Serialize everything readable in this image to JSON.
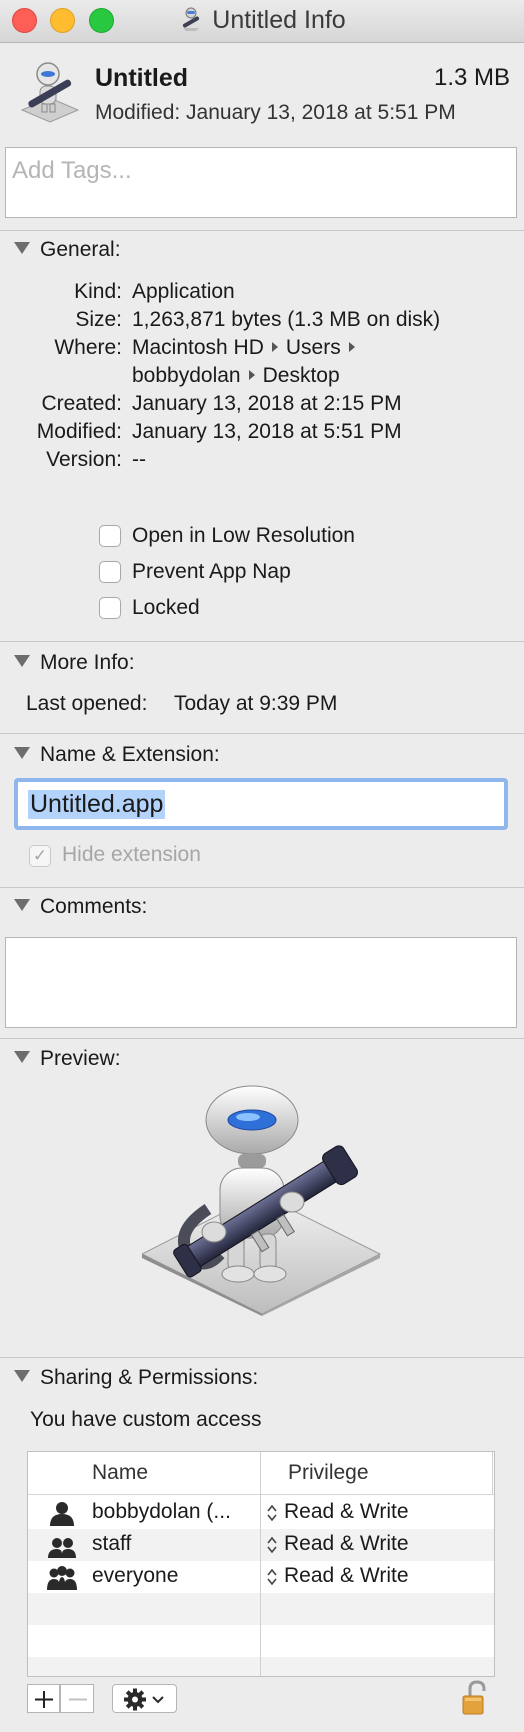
{
  "window": {
    "title": "Untitled Info",
    "title_icon": "automator-icon"
  },
  "header": {
    "name": "Untitled",
    "size": "1.3 MB",
    "modified": "Modified:  January 13, 2018 at 5:51 PM"
  },
  "tags": {
    "placeholder": "Add Tags..."
  },
  "general": {
    "title": "General:",
    "rows": [
      {
        "label": "Kind:",
        "value": "Application"
      },
      {
        "label": "Size:",
        "value": "1,263,871 bytes (1.3 MB on disk)"
      },
      {
        "label": "Where:",
        "value_parts": [
          "Macintosh HD",
          "Users",
          "bobbydolan",
          "Desktop"
        ]
      },
      {
        "label": "Created:",
        "value": "January 13, 2018 at 2:15 PM"
      },
      {
        "label": "Modified:",
        "value": "January 13, 2018 at 5:51 PM"
      },
      {
        "label": "Version:",
        "value": "--"
      }
    ],
    "checkboxes": [
      {
        "label": "Open in Low Resolution",
        "checked": false
      },
      {
        "label": "Prevent App Nap",
        "checked": false
      },
      {
        "label": "Locked",
        "checked": false
      }
    ]
  },
  "more_info": {
    "title": "More Info:",
    "last_opened_label": "Last opened:",
    "last_opened_value": "Today at 9:39 PM"
  },
  "name_extension": {
    "title": "Name & Extension:",
    "value": "Untitled.app",
    "hide_extension_label": "Hide extension",
    "hide_extension_checked": true,
    "hide_extension_mark": "✓"
  },
  "comments": {
    "title": "Comments:"
  },
  "preview": {
    "title": "Preview:",
    "image": "automator-robot-icon"
  },
  "sharing": {
    "title": "Sharing & Permissions:",
    "access_text": "You have custom access",
    "columns": [
      "Name",
      "Privilege"
    ],
    "rows": [
      {
        "name": "bobbydolan (...",
        "privilege": "Read & Write",
        "icon": "user-icon"
      },
      {
        "name": "staff",
        "privilege": "Read & Write",
        "icon": "group-icon"
      },
      {
        "name": "everyone",
        "privilege": "Read & Write",
        "icon": "everyone-icon"
      }
    ],
    "buttons": {
      "add": "+",
      "remove": "−",
      "gear": "gear-icon",
      "lock": "lock-icon"
    }
  }
}
